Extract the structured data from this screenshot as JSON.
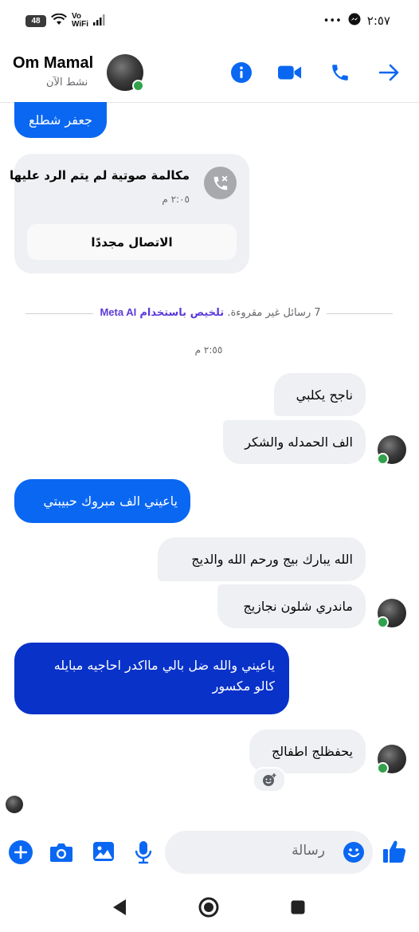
{
  "status_bar": {
    "battery": "48",
    "wifi_label": "Vo\nWiFi",
    "dots": "•••",
    "time": "٢:٥٧"
  },
  "header": {
    "contact_name": "Om Mamal",
    "active_status": "نشط الآن",
    "icons": [
      "info-icon",
      "video-call-icon",
      "phone-icon",
      "forward-arrow-icon"
    ]
  },
  "messages": {
    "sent_partial": "جعفر شطلع",
    "call_card": {
      "title": "مكالمة صوتية لم يتم الرد عليها",
      "time": "٢:٠٥ م",
      "callback_button": "الاتصال مجددًا"
    },
    "unread_count": "7 رسائل غير مقروءة.",
    "summarize_link": "تلخيص باستخدام",
    "meta_ai": "Meta AI",
    "timestamp": "٢:٥٥ م",
    "recv_1": "ناجح يكلبي",
    "recv_2": "الف الحمدله والشكر",
    "sent_1": "ياعيني الف مبروك حبيبتي",
    "recv_3": "الله يبارك بيج ورحم الله والديج",
    "recv_4": "ماندري شلون نجازيج",
    "sent_2_line1": "ياعيني والله ضل بالي مااكدر احاجيه مبايله",
    "sent_2_line2": "كالو مكسور",
    "recv_5": "يحفظلج اطفالج"
  },
  "composer": {
    "placeholder": "رسالة",
    "icons": [
      "plus-icon",
      "camera-icon",
      "gallery-icon",
      "microphone-icon",
      "emoji-icon",
      "thumbs-up-icon"
    ]
  },
  "colors": {
    "accent": "#0a67f2",
    "sent_dark": "#0932c9",
    "received_bg": "#eff0f3",
    "online": "#31a24c",
    "meta_ai": "#5b3bdb"
  }
}
